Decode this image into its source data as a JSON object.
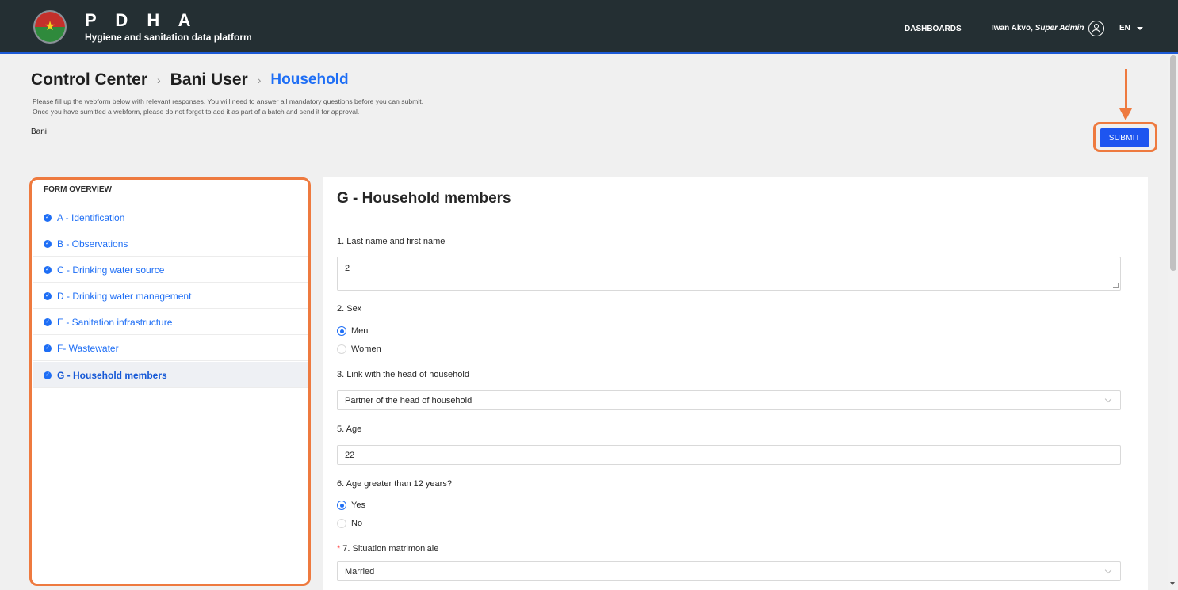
{
  "header": {
    "app_title": "P D H A",
    "app_subtitle": "Hygiene and sanitation data platform",
    "nav_dashboards": "DASHBOARDS",
    "user_name": "Iwan Akvo, ",
    "user_role": "Super Admin",
    "language": "EN",
    "colors": {
      "background": "#242f33",
      "accent_line": "#1c5ad6"
    }
  },
  "breadcrumb": {
    "items": [
      "Control Center",
      "Bani User"
    ],
    "current": "Household",
    "separator": "›"
  },
  "description": {
    "line1": "Please fill up the webform below with relevant responses. You will need to answer all mandatory questions before you can submit.",
    "line2": "Once you have sumitted a webform, please do not forget to add it as part of a batch and send it for approval."
  },
  "form_owner": "Bani",
  "submit_label": "SUBMIT",
  "annotation_color": "#ee7a3f",
  "overview": {
    "title": "FORM OVERVIEW",
    "items": [
      {
        "label": "A - Identification",
        "completed": true
      },
      {
        "label": "B - Observations",
        "completed": true
      },
      {
        "label": "C - Drinking water source",
        "completed": true
      },
      {
        "label": "D - Drinking water management",
        "completed": true
      },
      {
        "label": "E - Sanitation infrastructure",
        "completed": true
      },
      {
        "label": "F- Wastewater",
        "completed": true
      },
      {
        "label": "G - Household members",
        "completed": true,
        "active": true
      }
    ]
  },
  "section": {
    "title": "G - Household members",
    "questions": [
      {
        "label": "1. Last name and first name",
        "type": "textarea",
        "value": "2"
      },
      {
        "label": "2. Sex",
        "type": "radio",
        "options": [
          "Men",
          "Women"
        ],
        "selected": "Men"
      },
      {
        "label": "3. Link with the head of household",
        "type": "select",
        "value": "Partner of the head of household"
      },
      {
        "label": "5. Age",
        "type": "input",
        "value": "22"
      },
      {
        "label": "6. Age greater than 12 years?",
        "type": "radio",
        "options": [
          "Yes",
          "No"
        ],
        "selected": "Yes"
      },
      {
        "label": "7. Situation matrimoniale",
        "type": "select",
        "value": "Married",
        "required": true
      }
    ]
  }
}
